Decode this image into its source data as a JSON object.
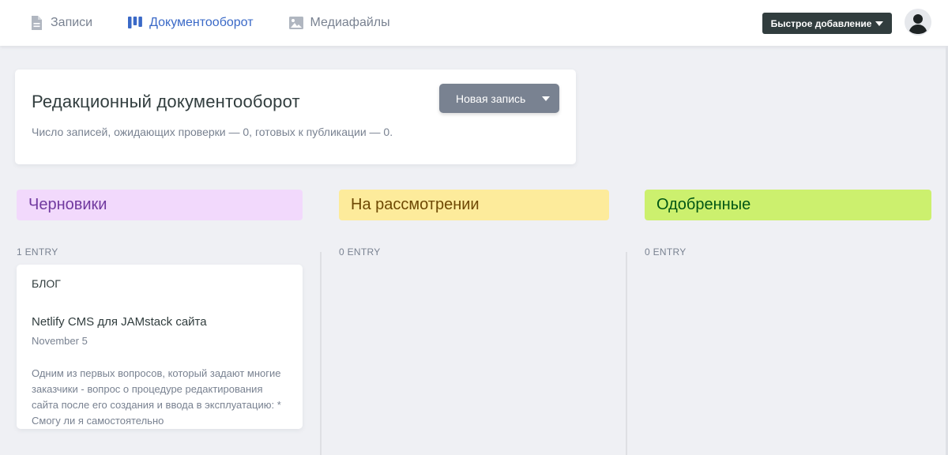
{
  "nav": {
    "items": [
      {
        "label": "Записи",
        "icon": "document-icon",
        "active": false
      },
      {
        "label": "Документооборот",
        "icon": "workflow-icon",
        "active": true
      },
      {
        "label": "Медиафайлы",
        "icon": "media-icon",
        "active": false
      }
    ],
    "quick_add": "Быстрое добавление"
  },
  "header": {
    "title": "Редакционный документооборот",
    "subtitle": "Число записей, ожидающих проверки — 0, готовых к публикации — 0.",
    "new_entry": "Новая запись"
  },
  "columns": [
    {
      "title": "Черновики",
      "count": "1 ENTRY",
      "color": "#f2d9fc"
    },
    {
      "title": "На рассмотрении",
      "count": "0 ENTRY",
      "color": "#fdeb9b"
    },
    {
      "title": "Одобренные",
      "count": "0 ENTRY",
      "color": "#ccf06e"
    }
  ],
  "cards": [
    {
      "collection": "БЛОГ",
      "title": "Netlify CMS для JAMstack сайта",
      "date": "November 5",
      "excerpt": "Одним из первых вопросов, который задают многие заказчики - вопрос о процедуре редактирования сайта после его создания и ввода в эксплуатацию: * Смогу ли я самостоятельно"
    }
  ],
  "colors": {
    "accent": "#3a69c7",
    "dark": "#313d3e",
    "muted": "#798291"
  }
}
